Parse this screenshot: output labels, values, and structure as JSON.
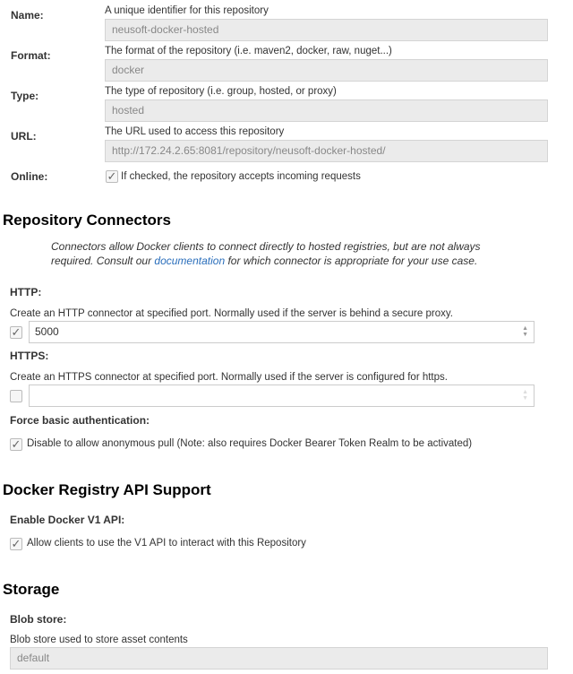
{
  "fields": [
    {
      "label": "Name:",
      "help": "A unique identifier for this repository",
      "value": "neusoft-docker-hosted"
    },
    {
      "label": "Format:",
      "help": "The format of the repository (i.e. maven2, docker, raw, nuget...)",
      "value": "docker"
    },
    {
      "label": "Type:",
      "help": "The type of repository (i.e. group, hosted, or proxy)",
      "value": "hosted"
    },
    {
      "label": "URL:",
      "help": "The URL used to access this repository",
      "value": "http://172.24.2.65:8081/repository/neusoft-docker-hosted/"
    }
  ],
  "online": {
    "label": "Online:",
    "text": "If checked, the repository accepts incoming requests",
    "checked": true
  },
  "connectors": {
    "title": "Repository Connectors",
    "intro_before": "Connectors allow Docker clients to connect directly to hosted registries, but are not always required. Consult our ",
    "intro_link": "documentation",
    "intro_after": " for which connector is appropriate for your use case.",
    "http": {
      "label": "HTTP:",
      "help": "Create an HTTP connector at specified port. Normally used if the server is behind a secure proxy.",
      "checked": true,
      "value": "5000"
    },
    "https": {
      "label": "HTTPS:",
      "help": "Create an HTTPS connector at specified port. Normally used if the server is configured for https.",
      "checked": false,
      "value": ""
    },
    "force": {
      "label": "Force basic authentication:",
      "text": "Disable to allow anonymous pull (Note: also requires Docker Bearer Token Realm to be activated)",
      "checked": true
    }
  },
  "api": {
    "title": "Docker Registry API Support",
    "label": "Enable Docker V1 API:",
    "text": "Allow clients to use the V1 API to interact with this Repository",
    "checked": true
  },
  "storage": {
    "title": "Storage",
    "label": "Blob store:",
    "help": "Blob store used to store asset contents",
    "value": "default"
  }
}
